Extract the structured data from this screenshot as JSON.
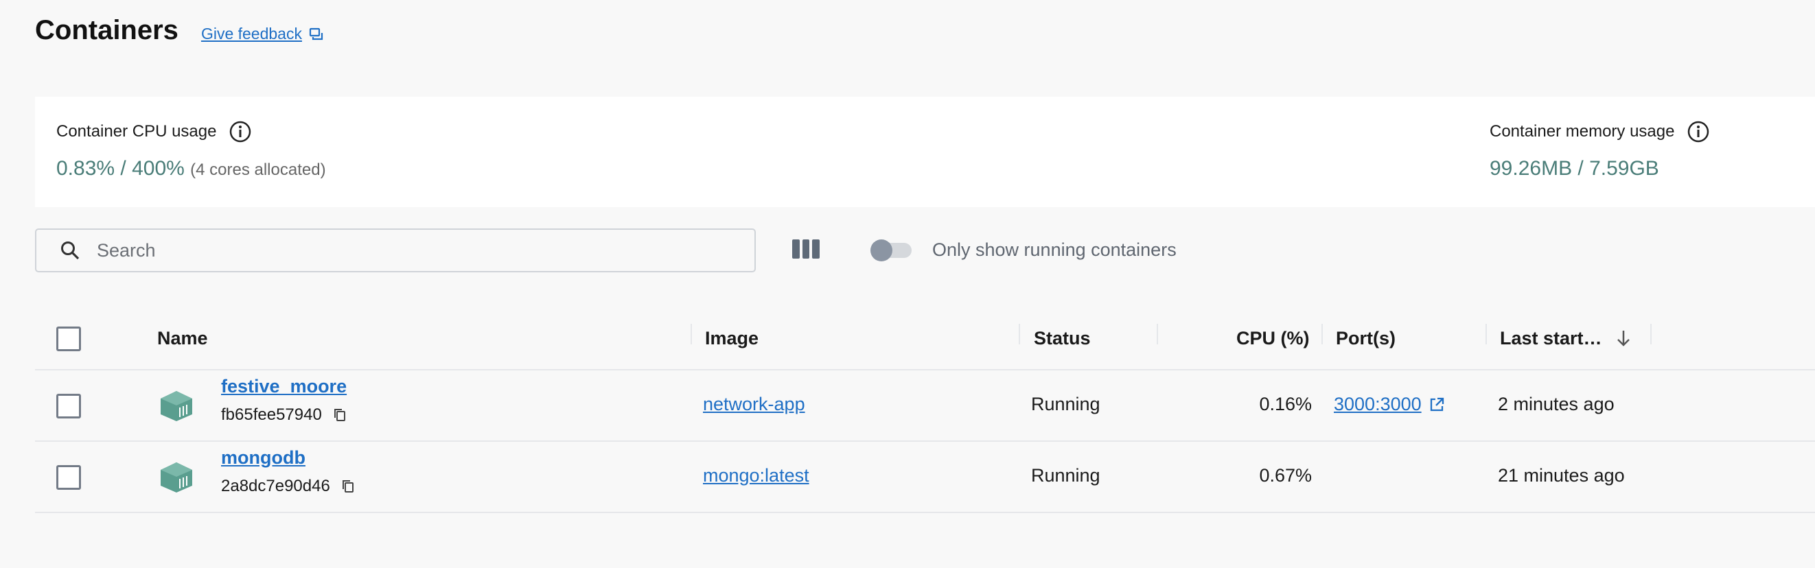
{
  "header": {
    "title": "Containers",
    "feedback_label": "Give feedback"
  },
  "stats": {
    "cpu": {
      "label": "Container CPU usage",
      "value": "0.83% / 400%",
      "note": "(4 cores allocated)"
    },
    "memory": {
      "label": "Container memory usage",
      "value": "99.26MB / 7.59GB"
    }
  },
  "toolbar": {
    "search_placeholder": "Search",
    "toggle_label": "Only show running containers",
    "toggle_on": false
  },
  "table": {
    "columns": [
      "Name",
      "Image",
      "Status",
      "CPU (%)",
      "Port(s)",
      "Last start…"
    ],
    "rows": [
      {
        "name": "festive_moore",
        "id": "fb65fee57940",
        "image": "network-app",
        "status": "Running",
        "cpu": "0.16%",
        "ports": "3000:3000",
        "last_started": "2 minutes ago"
      },
      {
        "name": "mongodb",
        "id": "2a8dc7e90d46",
        "image": "mongo:latest",
        "status": "Running",
        "cpu": "0.67%",
        "ports": "",
        "last_started": "21 minutes ago"
      }
    ]
  },
  "colors": {
    "accent_link": "#1f6fc5",
    "stat_value": "#4a7d78",
    "container_icon": "#5a9e8f"
  },
  "icons": [
    "feedback-icon",
    "info-icon",
    "search-icon",
    "columns-icon",
    "container-icon",
    "copy-icon",
    "external-link-icon",
    "sort-down-icon"
  ]
}
